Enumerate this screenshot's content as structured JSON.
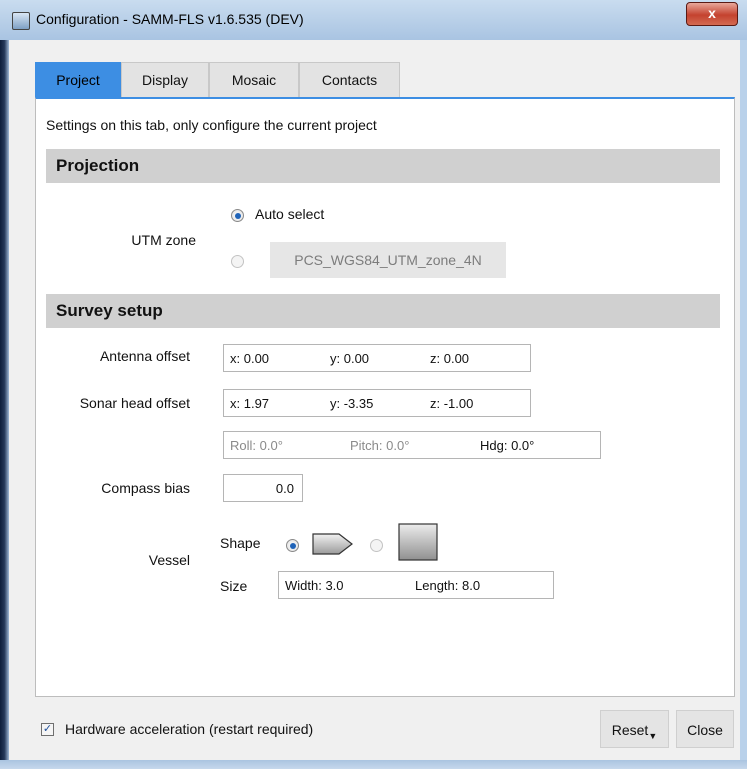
{
  "window": {
    "title": "Configuration - SAMM-FLS v1.6.535 (DEV)",
    "close_glyph": "x",
    "icon": "app-window-icon"
  },
  "tabs": [
    {
      "label": "Project",
      "active": true
    },
    {
      "label": "Display",
      "active": false
    },
    {
      "label": "Mosaic",
      "active": false
    },
    {
      "label": "Contacts",
      "active": false
    }
  ],
  "project": {
    "intro": "Settings on this tab, only configure the current project",
    "projection": {
      "heading": "Projection",
      "utm_label": "UTM zone",
      "auto_select_label": "Auto select",
      "auto_selected": true,
      "zone_value": "PCS_WGS84_UTM_zone_4N"
    },
    "survey": {
      "heading": "Survey setup",
      "antenna_label": "Antenna offset",
      "antenna": {
        "x": "x: 0.00",
        "y": "y: 0.00",
        "z": "z: 0.00"
      },
      "sonar_label": "Sonar head offset",
      "sonar": {
        "x": "x: 1.97",
        "y": "y: -3.35",
        "z": "z: -1.00"
      },
      "attitude": {
        "roll": "Roll: 0.0°",
        "pitch": "Pitch: 0.0°",
        "hdg": "Hdg: 0.0°"
      },
      "compass_label": "Compass bias",
      "compass_value": "0.0",
      "vessel_label": "Vessel",
      "shape_label": "Shape",
      "shape_selected": "boat",
      "size_label": "Size",
      "width": "Width: 3.0",
      "length": "Length: 8.0"
    }
  },
  "footer": {
    "hw_accel_label": "Hardware acceleration (restart required)",
    "hw_accel_checked": true,
    "reset_label": "Reset",
    "close_label": "Close"
  },
  "colors": {
    "tab_active": "#3d8ee3",
    "section_bg": "#d0d0d0",
    "radio_dot": "#1f63b8"
  }
}
